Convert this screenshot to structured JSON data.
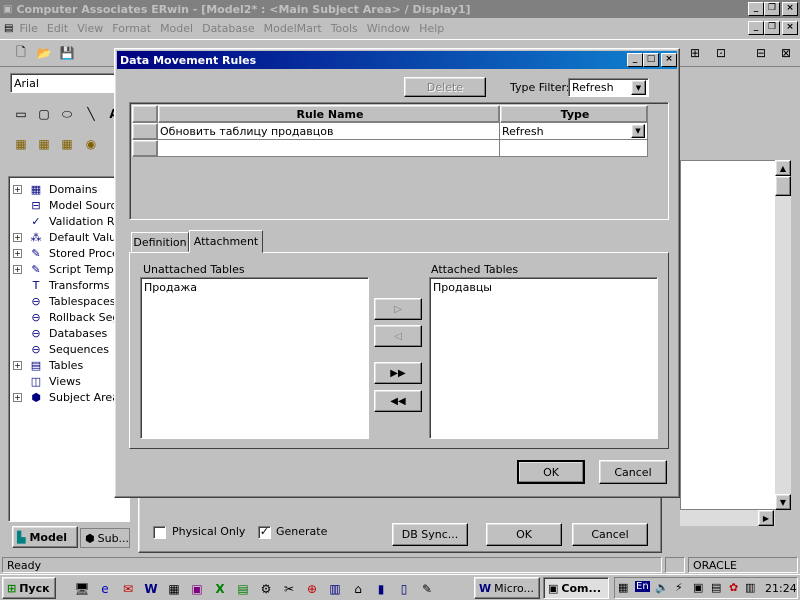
{
  "app": {
    "title": "Computer Associates ERwin - [Model2* : <Main Subject Area> / Display1]",
    "menu": [
      "File",
      "Edit",
      "View",
      "Format",
      "Model",
      "Database",
      "ModelMart",
      "Tools",
      "Window",
      "Help"
    ],
    "font_name": "Arial",
    "status_left": "Ready",
    "status_db": "ORACLE"
  },
  "tree": {
    "items": [
      {
        "label": "Domains",
        "expand": "+",
        "icon": "domains-icon"
      },
      {
        "label": "Model Sourc",
        "expand": "",
        "icon": "model-source-icon"
      },
      {
        "label": "Validation Ru",
        "expand": "",
        "icon": "validation-rule-icon"
      },
      {
        "label": "Default Value",
        "expand": "+",
        "icon": "default-value-icon"
      },
      {
        "label": "Stored Proce",
        "expand": "+",
        "icon": "stored-procedure-icon"
      },
      {
        "label": "Script Templ",
        "expand": "+",
        "icon": "script-template-icon"
      },
      {
        "label": "Transforms",
        "expand": "",
        "icon": "transform-icon"
      },
      {
        "label": "Tablespaces",
        "expand": "",
        "icon": "tablespace-icon"
      },
      {
        "label": "Rollback Seg",
        "expand": "",
        "icon": "rollback-segment-icon"
      },
      {
        "label": "Databases",
        "expand": "",
        "icon": "database-icon"
      },
      {
        "label": "Sequences",
        "expand": "",
        "icon": "sequence-icon"
      },
      {
        "label": "Tables",
        "expand": "+",
        "icon": "table-icon"
      },
      {
        "label": "Views",
        "expand": "",
        "icon": "view-icon"
      },
      {
        "label": "Subject Area",
        "expand": "+",
        "icon": "subject-area-icon"
      }
    ],
    "tab_model": "Model",
    "tab_sub": "Sub..."
  },
  "bg_dialog": {
    "physical_only": "Physical Only",
    "generate": "Generate",
    "db_sync": "DB Sync...",
    "ok": "OK",
    "cancel": "Cancel"
  },
  "dialog": {
    "title": "Data Movement Rules",
    "delete": "Delete",
    "type_filter_label": "Type Filter:",
    "type_filter_value": "Refresh",
    "col_rule_name": "Rule Name",
    "col_type": "Type",
    "rows": [
      {
        "name": "Обновить таблицу продавцов",
        "type": "Refresh"
      }
    ],
    "tab_definition": "Definition",
    "tab_attachment": "Attachment",
    "unattached_label": "Unattached Tables",
    "attached_label": "Attached Tables",
    "unattached": [
      "Продажа"
    ],
    "attached": [
      "Продавцы"
    ],
    "ok": "OK",
    "cancel": "Cancel"
  },
  "taskbar": {
    "start": "Пуск",
    "tasks": [
      "Micro...",
      "Com..."
    ],
    "lang": "En",
    "clock": "21:24"
  }
}
